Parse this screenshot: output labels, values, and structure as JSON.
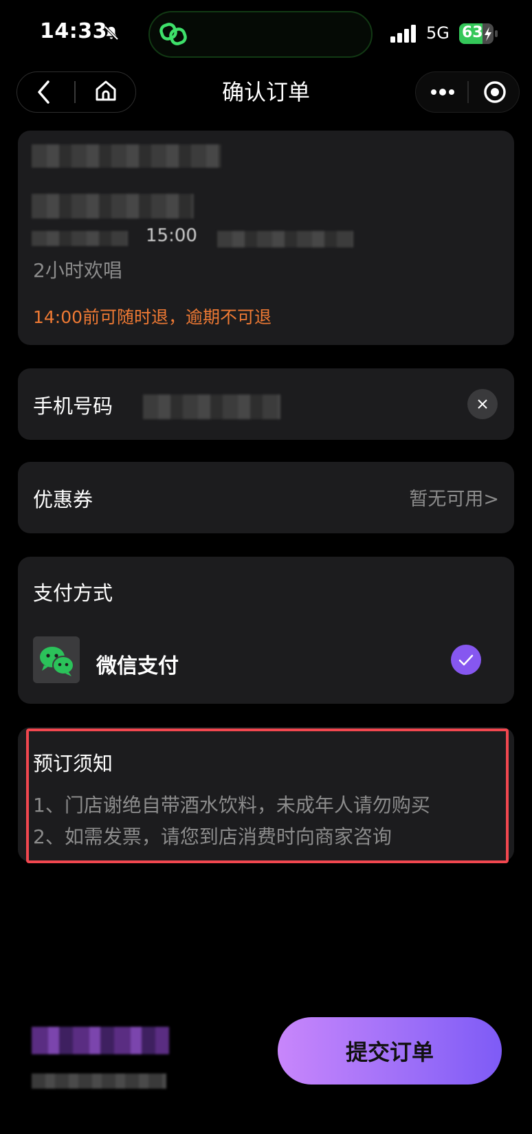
{
  "status_bar": {
    "time": "14:33",
    "network": "5G",
    "battery": "63",
    "icons": [
      "mute-bell-icon",
      "signal-icon",
      "battery-charging-icon"
    ]
  },
  "nav": {
    "title": "确认订单",
    "icons": [
      "back-icon",
      "home-icon",
      "more-icon",
      "record-icon"
    ]
  },
  "order": {
    "duration": "2小时欢唱",
    "refund_policy": "14:00前可随时退，逾期不可退",
    "time_partial": "15:00"
  },
  "phone": {
    "label": "手机号码"
  },
  "coupon": {
    "label": "优惠券",
    "value": "暂无可用>"
  },
  "payment": {
    "title": "支付方式",
    "method": "微信支付",
    "selected": true,
    "accent": "#8657f0"
  },
  "notice": {
    "title": "预订须知",
    "lines": [
      "1、门店谢绝自带酒水饮料，未成年人请勿购买",
      "2、如需发票，请您到店消费时向商家咨询"
    ],
    "highlight_color": "#f2474f"
  },
  "footer": {
    "submit_label": "提交订单"
  }
}
